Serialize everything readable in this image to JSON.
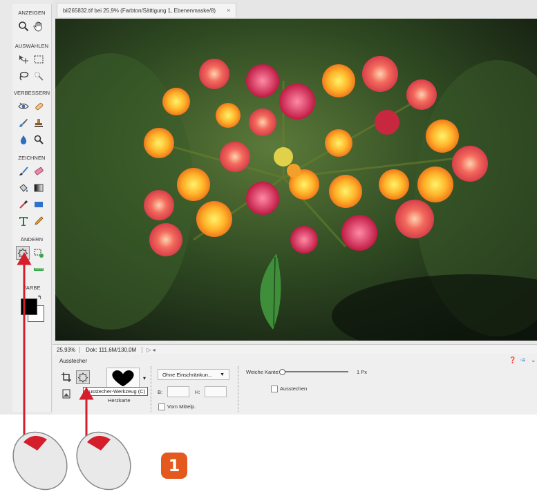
{
  "document_tab": {
    "title": "bil265832.tif bei 25,9% (Farbton/Sättigung 1, Ebenenmaske/8)",
    "close_glyph": "×"
  },
  "toolbox": {
    "sections": {
      "view": "ANZEIGEN",
      "select": "AUSWÄHLEN",
      "enhance": "VERBESSERN",
      "draw": "ZEICHNEN",
      "modify": "ÄNDERN",
      "color": "FARBE"
    },
    "foreground_color": "#000000",
    "background_color": "#ffffff"
  },
  "status_bar": {
    "zoom": "25,93%",
    "doc_size": "Dok: 111,6M/130,0M",
    "arrow": "▷ ◂"
  },
  "options_bar": {
    "tool_title": "Ausstecher",
    "shape_name": "Herzkarte",
    "tooltip": "Ausstecher-Werkzeug (C)",
    "constraint_dropdown": "Ohne Einschränkun...",
    "width_label": "B:",
    "height_label": "H:",
    "from_center_label": "Vom Mittelp.",
    "feather_label": "Weiche Kante:",
    "feather_value": "1 Px",
    "crop_label": "Ausstechen"
  },
  "step_badge": "1",
  "colors": {
    "arrow_red": "#d41e2b",
    "badge_orange": "#e3591e"
  }
}
